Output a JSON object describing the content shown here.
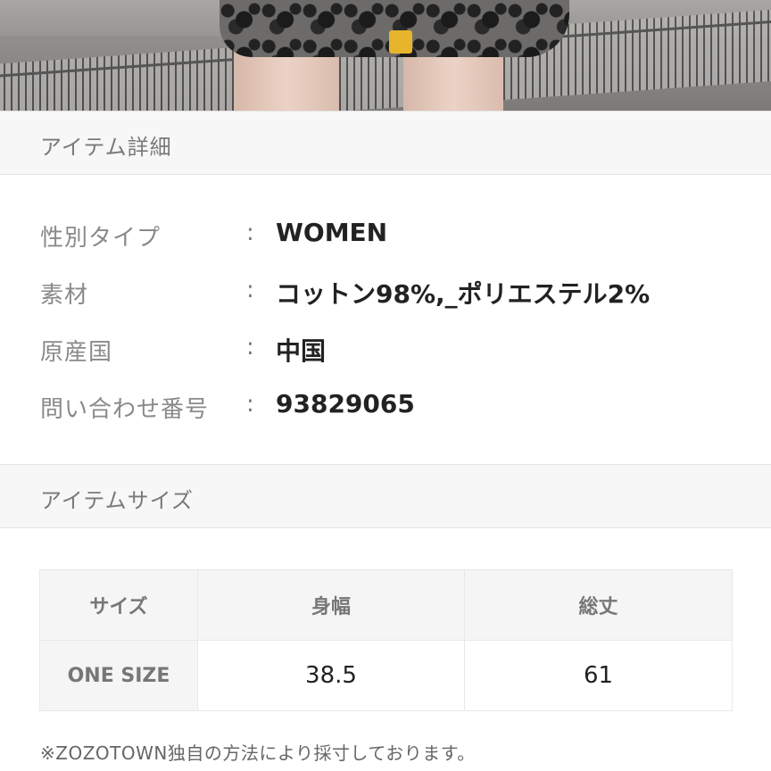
{
  "details_section": {
    "heading": "アイテム詳細",
    "rows": [
      {
        "label": "性別タイプ",
        "separator": ":",
        "value": "WOMEN"
      },
      {
        "label": "素材",
        "separator": ":",
        "value": "コットン98%,_ポリエステル2%"
      },
      {
        "label": "原産国",
        "separator": ":",
        "value": "中国"
      },
      {
        "label": "問い合わせ番号",
        "separator": ":",
        "value": "93829065"
      }
    ]
  },
  "size_section": {
    "heading": "アイテムサイズ",
    "table": {
      "headers": [
        "サイズ",
        "身幅",
        "総丈"
      ],
      "rows": [
        {
          "size": "ONE SIZE",
          "width": "38.5",
          "length": "61"
        }
      ]
    },
    "note": "※ZOZOTOWN独自の方法により採寸しております。"
  },
  "colors": {
    "section_bg": "#f7f7f7",
    "border": "#e4e4e4",
    "label_text": "#8a8a8a",
    "value_text": "#222222"
  }
}
